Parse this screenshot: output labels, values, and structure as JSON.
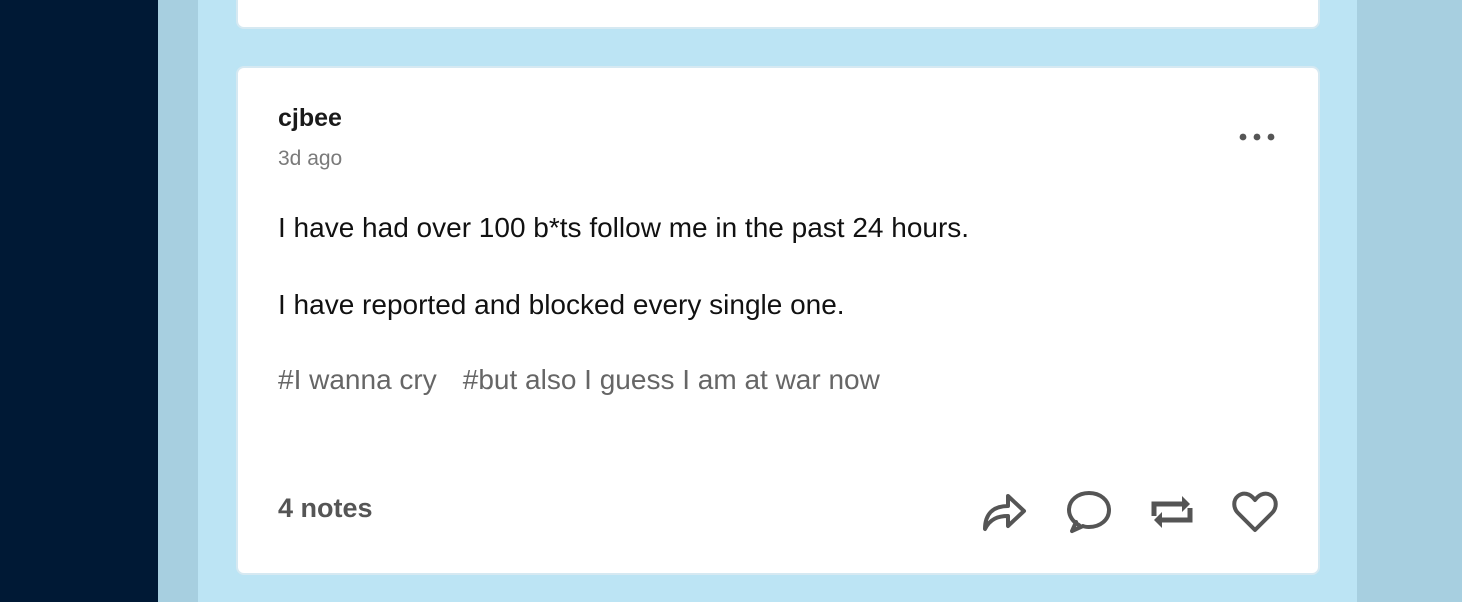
{
  "post": {
    "author": "cjbee",
    "timestamp": "3d ago",
    "body": [
      "I have had over 100 b*ts follow me in the past 24 hours.",
      "I have reported and blocked every single one."
    ],
    "tags": [
      "#I wanna cry",
      "#but also I guess I am at war now"
    ],
    "notes_label": "4 notes",
    "actions": [
      "share-icon",
      "reply-icon",
      "reblog-icon",
      "like-icon"
    ]
  },
  "colors": {
    "nav_background": "#001935",
    "feed_background": "#bce4f4",
    "card_background": "#ffffff",
    "tag_text": "#666666"
  }
}
